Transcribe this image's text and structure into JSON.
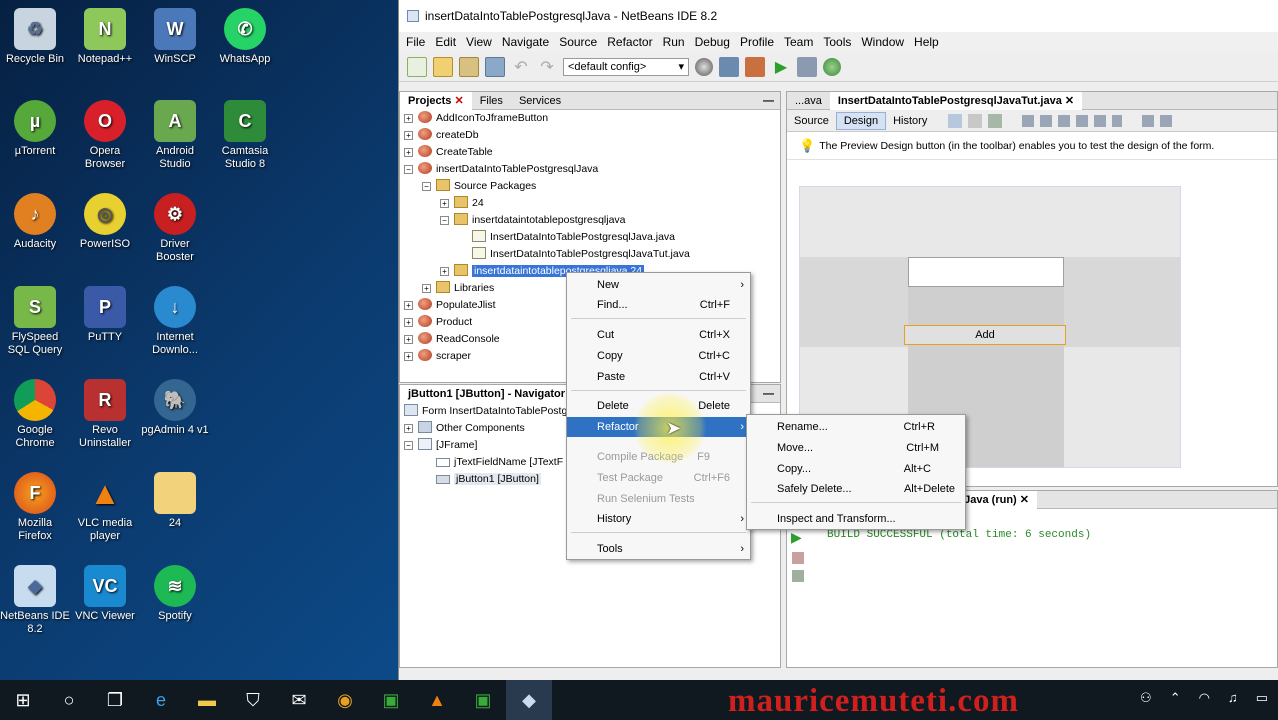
{
  "desktop": {
    "icons": [
      {
        "label": "Recycle Bin"
      },
      {
        "label": "Notepad++"
      },
      {
        "label": "WinSCP"
      },
      {
        "label": "WhatsApp"
      },
      {
        "label": "µTorrent"
      },
      {
        "label": "Opera Browser"
      },
      {
        "label": "Android Studio"
      },
      {
        "label": "Camtasia Studio 8"
      },
      {
        "label": "Audacity"
      },
      {
        "label": "PowerISO"
      },
      {
        "label": "Driver Booster"
      },
      {
        "label": "FlySpeed SQL Query"
      },
      {
        "label": "PuTTY"
      },
      {
        "label": "Internet Downlo..."
      },
      {
        "label": "Google Chrome"
      },
      {
        "label": "Revo Uninstaller"
      },
      {
        "label": "pgAdmin 4 v1"
      },
      {
        "label": "Mozilla Firefox"
      },
      {
        "label": "VLC media player"
      },
      {
        "label": "24"
      },
      {
        "label": "NetBeans IDE 8.2"
      },
      {
        "label": "VNC Viewer"
      },
      {
        "label": "Spotify"
      }
    ]
  },
  "window": {
    "title": "insertDataIntoTablePostgresqlJava - NetBeans IDE 8.2"
  },
  "menu": [
    "File",
    "Edit",
    "View",
    "Navigate",
    "Source",
    "Refactor",
    "Run",
    "Debug",
    "Profile",
    "Team",
    "Tools",
    "Window",
    "Help"
  ],
  "toolbar": {
    "config": "<default config>"
  },
  "projects": {
    "tabs": [
      "Projects",
      "Files",
      "Services"
    ],
    "tree": [
      {
        "label": "AddIconToJframeButton"
      },
      {
        "label": "createDb"
      },
      {
        "label": "CreateTable"
      },
      {
        "label": "insertDataIntoTablePostgresqlJava"
      },
      {
        "label": "Source Packages"
      },
      {
        "label": "24"
      },
      {
        "label": "insertdataintotablepostgresqljava"
      },
      {
        "label": "InsertDataIntoTablePostgresqlJava.java"
      },
      {
        "label": "InsertDataIntoTablePostgresqlJavaTut.java"
      },
      {
        "label": "insertdataintotablepostgresqljava.24"
      },
      {
        "label": "Libraries"
      },
      {
        "label": "PopulateJlist"
      },
      {
        "label": "Product"
      },
      {
        "label": "ReadConsole"
      },
      {
        "label": "scraper"
      }
    ]
  },
  "navigator": {
    "title": "jButton1 [JButton] - Navigator",
    "tree": [
      {
        "label": "Form InsertDataIntoTablePostg"
      },
      {
        "label": "Other Components"
      },
      {
        "label": "[JFrame]"
      },
      {
        "label": "jTextFieldName [JTextF"
      },
      {
        "label": "jButton1 [JButton]"
      }
    ]
  },
  "editor": {
    "tabs": [
      "...ava",
      "InsertDataIntoTablePostgresqlJavaTut.java"
    ],
    "views": [
      "Source",
      "Design",
      "History"
    ],
    "hint": "The Preview Design button (in the toolbar) enables you to test the design of the form.",
    "button_label": "Add"
  },
  "output": {
    "tab": "resqlJava (run)",
    "text": "BUILD SUCCESSFUL (total time: 6 seconds)"
  },
  "context_menu": [
    {
      "label": "New",
      "shortcut": "",
      "submenu": true
    },
    {
      "label": "Find...",
      "shortcut": "Ctrl+F"
    },
    {
      "label": "Cut",
      "shortcut": "Ctrl+X"
    },
    {
      "label": "Copy",
      "shortcut": "Ctrl+C"
    },
    {
      "label": "Paste",
      "shortcut": "Ctrl+V"
    },
    {
      "label": "Delete",
      "shortcut": "Delete"
    },
    {
      "label": "Refactor",
      "shortcut": "",
      "submenu": true
    },
    {
      "label": "Compile Package",
      "shortcut": "F9"
    },
    {
      "label": "Test Package",
      "shortcut": "Ctrl+F6"
    },
    {
      "label": "Run Selenium Tests",
      "shortcut": ""
    },
    {
      "label": "History",
      "shortcut": "",
      "submenu": true
    },
    {
      "label": "Tools",
      "shortcut": "",
      "submenu": true
    }
  ],
  "refactor_menu": [
    {
      "label": "Rename...",
      "shortcut": "Ctrl+R"
    },
    {
      "label": "Move...",
      "shortcut": "Ctrl+M"
    },
    {
      "label": "Copy...",
      "shortcut": "Alt+C"
    },
    {
      "label": "Safely Delete...",
      "shortcut": "Alt+Delete"
    },
    {
      "label": "Inspect and Transform...",
      "shortcut": ""
    }
  ],
  "watermark": "mauricemuteti.com",
  "colors": {
    "selection": "#3875d7",
    "menu_highlight": "#2f72c4",
    "watermark": "#d0201e",
    "build_text": "#2a8a2a"
  }
}
